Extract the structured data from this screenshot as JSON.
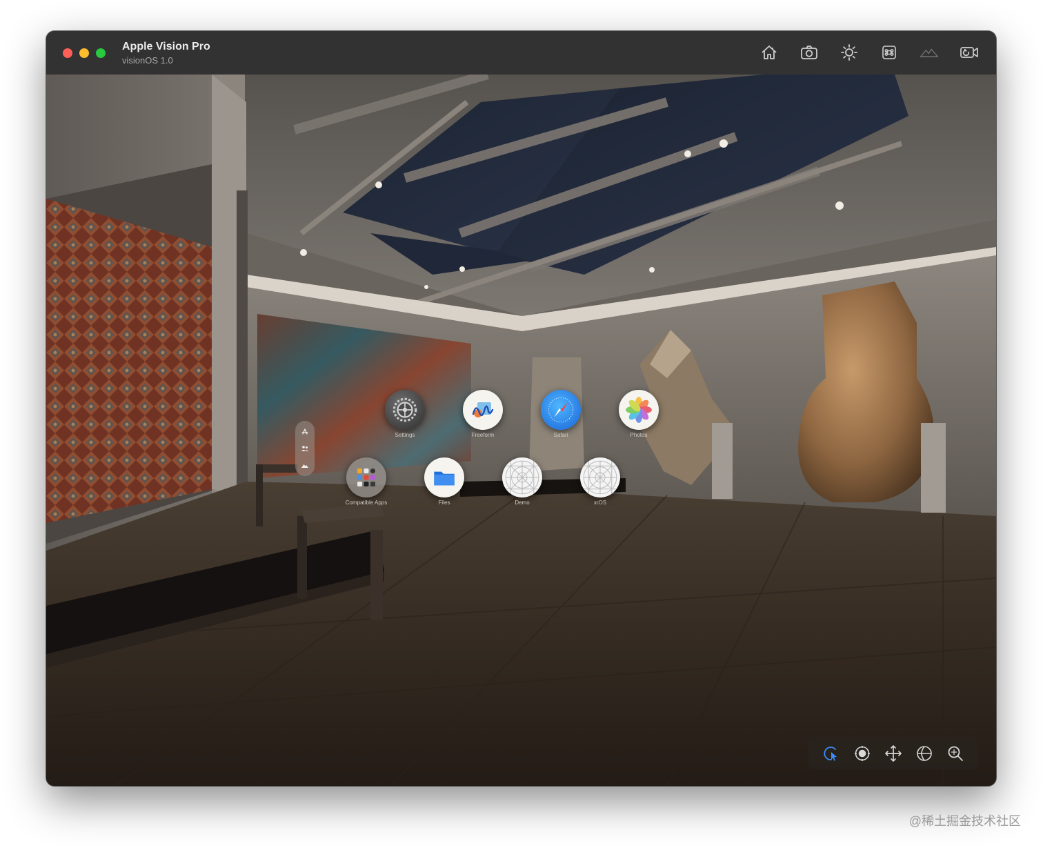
{
  "window": {
    "title": "Apple Vision Pro",
    "subtitle": "visionOS 1.0"
  },
  "toolbar": {
    "buttons": [
      {
        "icon": "home-icon"
      },
      {
        "icon": "camera-icon"
      },
      {
        "icon": "brightness-icon"
      },
      {
        "icon": "command-icon"
      },
      {
        "icon": "environment-mountains-icon"
      },
      {
        "icon": "record-video-icon"
      }
    ]
  },
  "home_view": {
    "apps_row1": [
      {
        "label": "Settings",
        "icon": "settings-gear-icon"
      },
      {
        "label": "Freeform",
        "icon": "freeform-icon"
      },
      {
        "label": "Safari",
        "icon": "safari-compass-icon"
      },
      {
        "label": "Photos",
        "icon": "photos-flower-icon"
      }
    ],
    "apps_row2": [
      {
        "label": "Compatible Apps",
        "icon": "compatible-apps-folder-icon"
      },
      {
        "label": "Files",
        "icon": "files-folder-icon"
      },
      {
        "label": "Demo",
        "icon": "placeholder-app-icon"
      },
      {
        "label": "xrOS",
        "icon": "placeholder-app-icon"
      }
    ],
    "ornament_tabs": [
      {
        "icon": "app-store-icon"
      },
      {
        "icon": "people-icon"
      },
      {
        "icon": "environments-icon"
      }
    ]
  },
  "interaction_bar": {
    "modes": [
      {
        "icon": "select-pointer-icon",
        "active": true
      },
      {
        "icon": "look-around-icon",
        "active": false
      },
      {
        "icon": "pan-icon",
        "active": false
      },
      {
        "icon": "orbit-icon",
        "active": false
      },
      {
        "icon": "zoom-icon",
        "active": false
      }
    ],
    "active_color": "#3a8cff"
  },
  "watermark": "@稀土掘金技术社区"
}
